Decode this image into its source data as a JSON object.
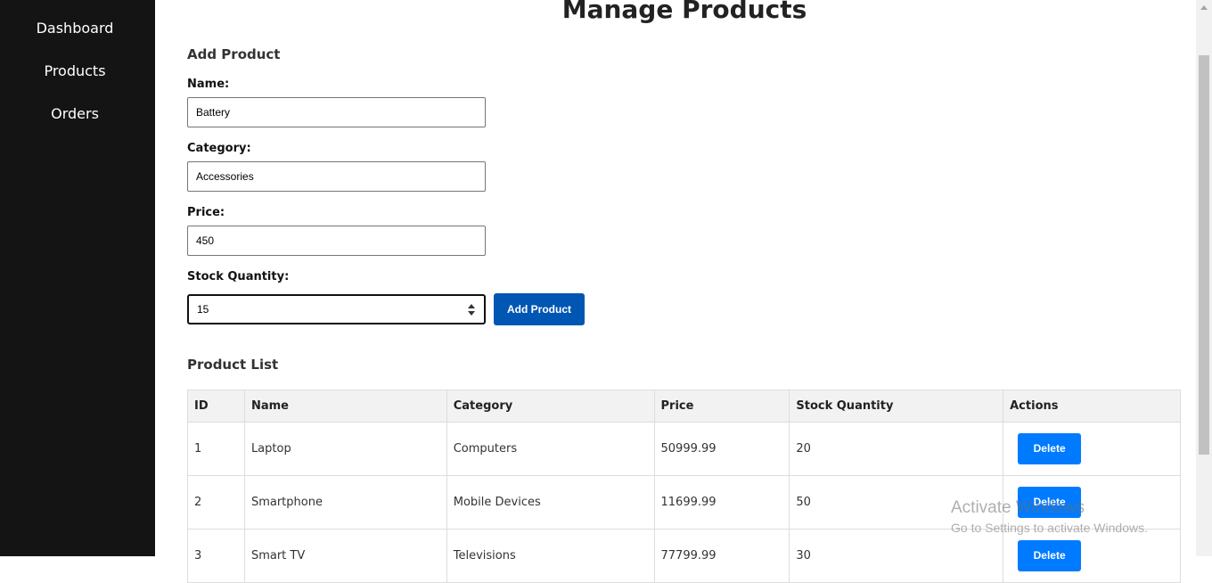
{
  "sidebar": {
    "items": [
      {
        "label": "Dashboard"
      },
      {
        "label": "Products"
      },
      {
        "label": "Orders"
      }
    ]
  },
  "main": {
    "title": "Manage Products"
  },
  "add_form": {
    "heading": "Add Product",
    "name": {
      "label": "Name:",
      "value": "Battery"
    },
    "category": {
      "label": "Category:",
      "value": "Accessories"
    },
    "price": {
      "label": "Price:",
      "value": "450"
    },
    "stock": {
      "label": "Stock Quantity:",
      "value": "15"
    },
    "submit_label": "Add Product"
  },
  "product_list": {
    "heading": "Product List",
    "columns": [
      "ID",
      "Name",
      "Category",
      "Price",
      "Stock Quantity",
      "Actions"
    ],
    "rows": [
      {
        "id": "1",
        "name": "Laptop",
        "category": "Computers",
        "price": "50999.99",
        "stock": "20",
        "action": "Delete"
      },
      {
        "id": "2",
        "name": "Smartphone",
        "category": "Mobile Devices",
        "price": "11699.99",
        "stock": "50",
        "action": "Delete"
      },
      {
        "id": "3",
        "name": "Smart TV",
        "category": "Televisions",
        "price": "77799.99",
        "stock": "30",
        "action": "Delete"
      }
    ]
  },
  "watermark": {
    "line1": "Activate Windows",
    "line2": "Go to Settings to activate Windows."
  },
  "colors": {
    "sidebar_bg": "#141414",
    "primary_button": "#0056b3",
    "delete_button": "#007bff",
    "table_header_bg": "#f2f2f2"
  }
}
